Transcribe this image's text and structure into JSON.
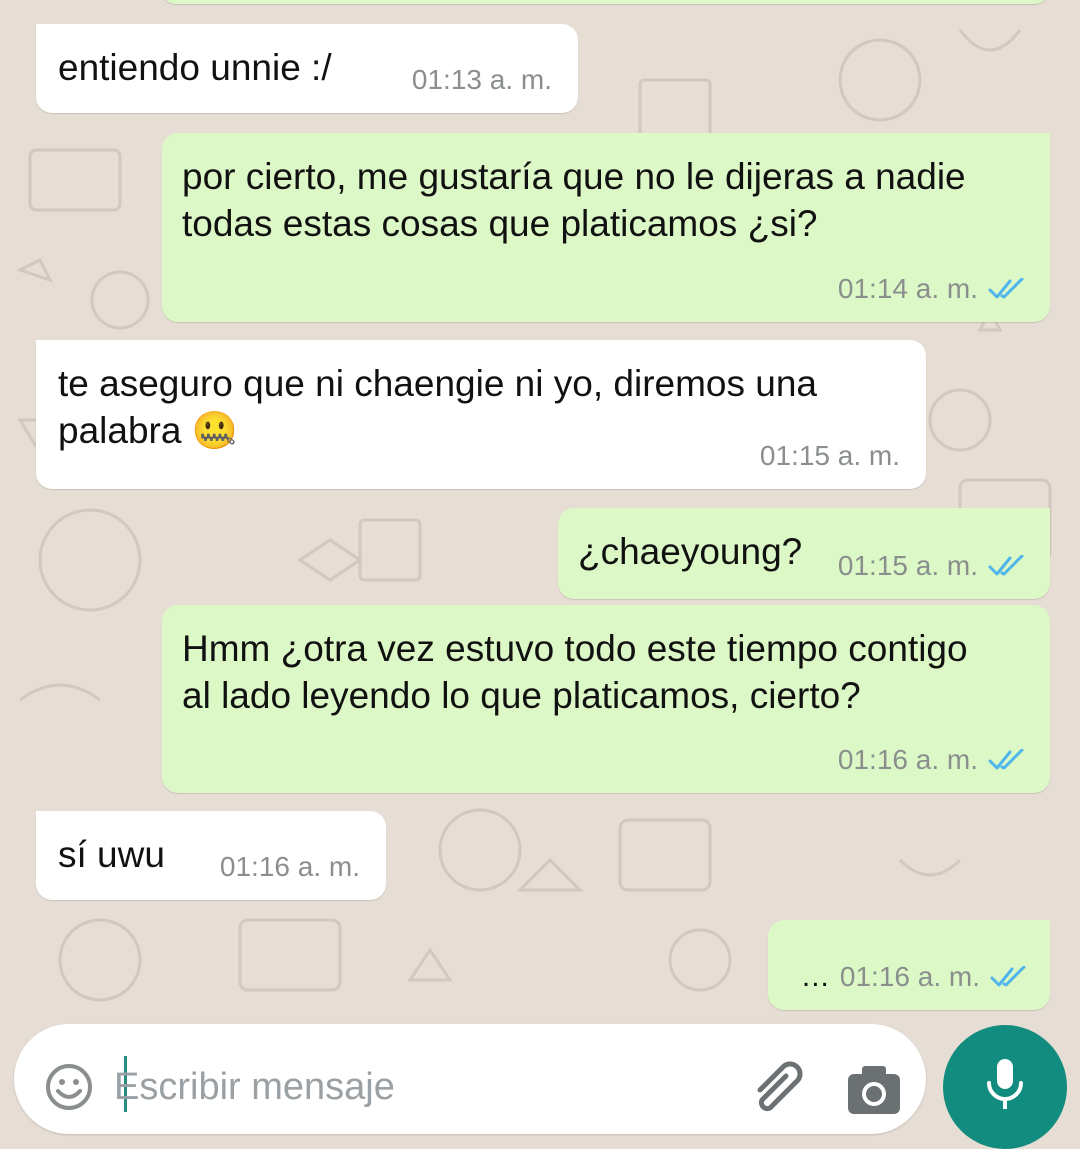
{
  "messages": [
    {
      "direction": "in",
      "text": "entiendo unnie :/",
      "time": "01:13 a. m."
    },
    {
      "direction": "out",
      "text": "por cierto, me gustaría que no le dijeras a nadie todas estas cosas que platicamos ¿si?",
      "time": "01:14 a. m.",
      "status": "read"
    },
    {
      "direction": "in",
      "text": "te aseguro que ni chaengie ni yo, diremos una palabra",
      "emoji": "🤐",
      "time": "01:15 a. m."
    },
    {
      "direction": "out",
      "text": "¿chaeyoung?",
      "time": "01:15 a. m.",
      "status": "read"
    },
    {
      "direction": "out",
      "text": "Hmm ¿otra vez estuvo todo este tiempo contigo al lado leyendo lo que platicamos, cierto?",
      "time": "01:16 a. m.",
      "status": "read"
    },
    {
      "direction": "in",
      "text": "sí uwu",
      "time": "01:16 a. m."
    },
    {
      "direction": "out",
      "text": "...",
      "time": "01:16 a. m.",
      "status": "read"
    }
  ],
  "composer": {
    "placeholder": "Escribir mensaje",
    "icons": [
      "emoji-icon",
      "attach-icon",
      "camera-icon",
      "mic-icon"
    ]
  },
  "colors": {
    "background": "#e6ddd4",
    "incoming_bubble": "#ffffff",
    "outgoing_bubble": "#dcf8c6",
    "read_ticks": "#4fb6ec",
    "mic_button": "#128c7e"
  }
}
